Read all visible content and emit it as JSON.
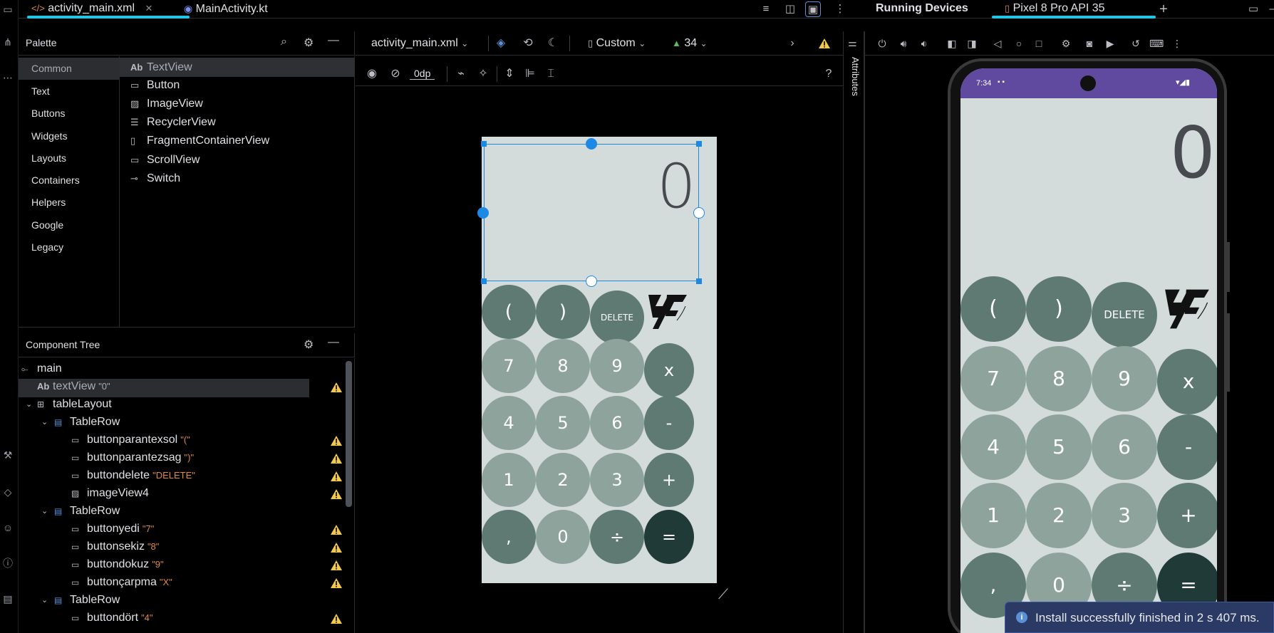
{
  "tabs": {
    "xml": "activity_main.xml",
    "kt": "MainActivity.kt"
  },
  "palette": {
    "title": "Palette",
    "categories": [
      "Common",
      "Text",
      "Buttons",
      "Widgets",
      "Layouts",
      "Containers",
      "Helpers",
      "Google",
      "Legacy"
    ],
    "items": [
      {
        "label": "TextView",
        "icon": "Ab"
      },
      {
        "label": "Button",
        "icon": "button-icon"
      },
      {
        "label": "ImageView",
        "icon": "image-icon"
      },
      {
        "label": "RecyclerView",
        "icon": "list-icon"
      },
      {
        "label": "FragmentContainerView",
        "icon": "fragment-icon"
      },
      {
        "label": "ScrollView",
        "icon": "scroll-icon"
      },
      {
        "label": "Switch",
        "icon": "switch-icon"
      }
    ]
  },
  "tree": {
    "title": "Component Tree",
    "nodes": [
      {
        "label": "main",
        "quote": ""
      },
      {
        "label": "textView",
        "quote": "\"0\""
      },
      {
        "label": "tableLayout",
        "quote": ""
      },
      {
        "label": "TableRow",
        "quote": ""
      },
      {
        "label": "buttonparantexsol",
        "quote": "\"(\""
      },
      {
        "label": "buttonparantezsag",
        "quote": "\")\""
      },
      {
        "label": "buttondelete",
        "quote": "\"DELETE\""
      },
      {
        "label": "imageView4",
        "quote": ""
      },
      {
        "label": "TableRow",
        "quote": ""
      },
      {
        "label": "buttonyedi",
        "quote": "\"7\""
      },
      {
        "label": "buttonsekiz",
        "quote": "\"8\""
      },
      {
        "label": "buttondokuz",
        "quote": "\"9\""
      },
      {
        "label": "buttonçarpma",
        "quote": "\"X\""
      },
      {
        "label": "TableRow",
        "quote": ""
      },
      {
        "label": "buttondört",
        "quote": "\"4\""
      }
    ]
  },
  "design": {
    "file": "activity_main.xml",
    "device": "Custom",
    "api": "34",
    "margin": "0dp",
    "attributes": "Attributes",
    "display": "0"
  },
  "keys": {
    "row1": [
      "(",
      ")",
      "DELETE"
    ],
    "row2": [
      "7",
      "8",
      "9",
      "x"
    ],
    "row3": [
      "4",
      "5",
      "6",
      "-"
    ],
    "row4": [
      "1",
      "2",
      "3",
      "+"
    ],
    "row5": [
      ",",
      "0",
      "÷",
      "="
    ]
  },
  "colors": {
    "light": "#8ea39c",
    "mid": "#5e7a72",
    "dark": "#1f3a37",
    "bg": "#d3dcdb",
    "accent": "#20c6e3"
  },
  "running": {
    "title": "Running Devices",
    "device": "Pixel 8 Pro API 35",
    "time": "7:34",
    "display": "0"
  },
  "toast": {
    "text": "Install successfully finished in 2 s 407 ms."
  }
}
